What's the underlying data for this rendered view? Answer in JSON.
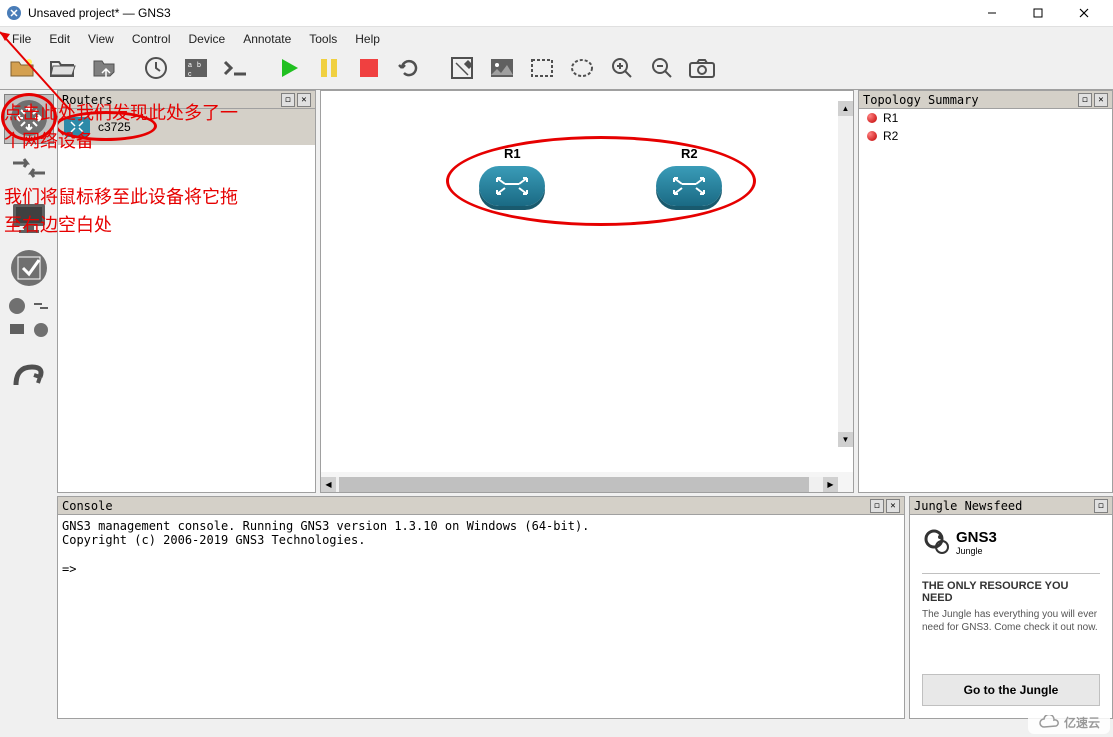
{
  "window": {
    "title": "Unsaved project* — GNS3"
  },
  "menu": {
    "file": "File",
    "edit": "Edit",
    "view": "View",
    "control": "Control",
    "device": "Device",
    "annotate": "Annotate",
    "tools": "Tools",
    "help": "Help"
  },
  "panels": {
    "routers": "Routers",
    "topology": "Topology Summary",
    "console": "Console",
    "jungle": "Jungle Newsfeed"
  },
  "devices": {
    "router1": "c3725"
  },
  "canvas": {
    "node1_label": "R1",
    "node2_label": "R2"
  },
  "topology": {
    "items": [
      {
        "name": "R1"
      },
      {
        "name": "R2"
      }
    ]
  },
  "console": {
    "line1": "GNS3 management console. Running GNS3 version 1.3.10 on Windows (64-bit).",
    "line2": "Copyright (c) 2006-2019 GNS3 Technologies.",
    "prompt": "=>"
  },
  "jungle": {
    "brand1": "GNS3",
    "brand2": "Jungle",
    "headline": "THE ONLY RESOURCE YOU NEED",
    "desc": "The Jungle has everything you will ever need for GNS3. Come check it out now.",
    "button": "Go to the Jungle"
  },
  "annotations": {
    "text1": "点击此处我们发现此处多了一个网络设备",
    "text2": "我们将鼠标移至此设备将它拖至右边空白处"
  },
  "watermark": "亿速云"
}
